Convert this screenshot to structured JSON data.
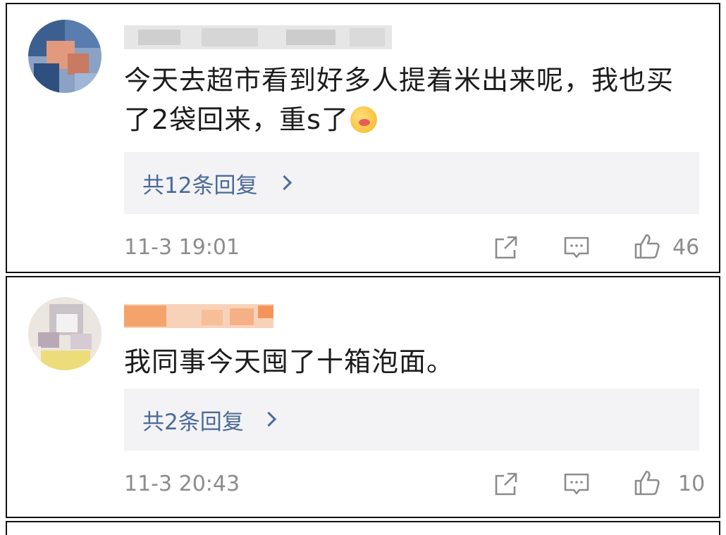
{
  "comments": [
    {
      "text": "今天去超市看到好多人提着米出来呢，我也买了2袋回来，重s了",
      "line1": "今天去超市看到好多人提着米出来呢，我也买",
      "line2": "了2袋回来，重s了",
      "emoji": "face-savoring-food-emoji",
      "replies_label": "共12条回复",
      "time": "11-3 19:01",
      "likes": "46",
      "name_color": "#c8c8c8"
    },
    {
      "text": "我同事今天囤了十箱泡面。",
      "replies_label": "共2条回复",
      "time": "11-3 20:43",
      "likes": "10",
      "name_color": "#f4a46a"
    }
  ],
  "icons": {
    "share": "share-icon",
    "comment": "comment-icon",
    "like": "thumbs-up-icon"
  },
  "colors": {
    "reply_link": "#4b6a9a",
    "reply_bg": "#f3f3f5",
    "meta_text": "#8c8c8c"
  }
}
